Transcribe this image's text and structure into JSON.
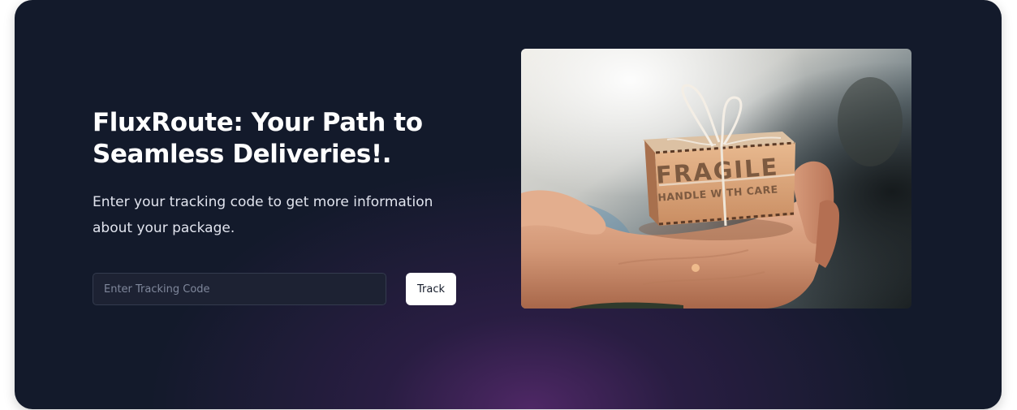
{
  "hero": {
    "title": "FluxRoute: Your Path to Seamless Deliveries!.",
    "subtitle": "Enter your tracking code to get more information about your package.",
    "tracking_input": {
      "placeholder": "Enter Tracking Code",
      "value": ""
    },
    "track_button_label": "Track"
  },
  "package_image": {
    "box_label_line1": "FRAGILE",
    "box_label_line2": "HANDLE WITH CARE"
  },
  "colors": {
    "background": "#131a2b",
    "accent_glow": "#592a70",
    "button_bg": "#ffffff",
    "text_primary": "#ffffff"
  }
}
